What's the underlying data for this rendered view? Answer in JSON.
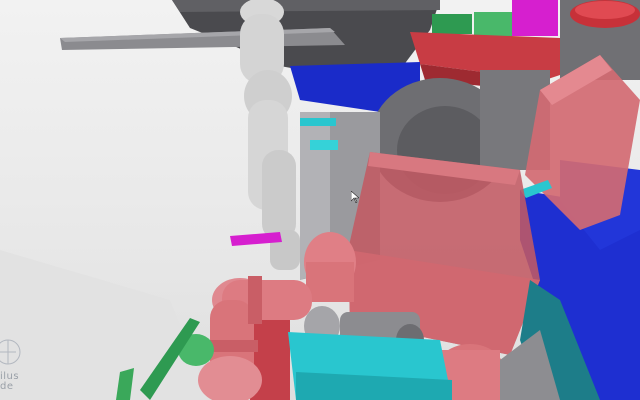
{
  "viewer": {
    "background": "#ececec",
    "watermark_text": "ilus\nde"
  },
  "colors": {
    "pipe_red": "#d9747a",
    "duct_red": "#c44048",
    "cyan": "#29c6cf",
    "blue": "#1e2fd1",
    "magenta": "#d61fcf",
    "green": "#49b86a",
    "motor_grey": "#8c8c90",
    "human": "#d8d8d8",
    "plank": "#8b8b8f"
  },
  "icons": {
    "cursor": "mouse-pointer-icon",
    "logo": "watermark-logo-icon"
  }
}
